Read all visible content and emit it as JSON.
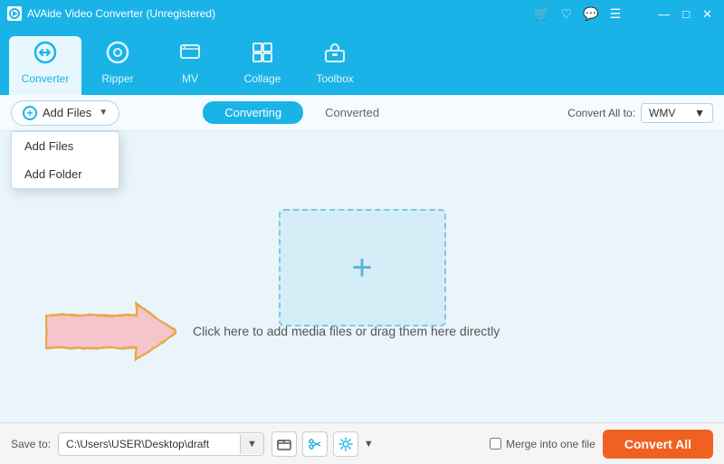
{
  "titlebar": {
    "title": "AVAide Video Converter (Unregistered)",
    "controls": {
      "minimize": "—",
      "maximize": "□",
      "close": "✕"
    },
    "icons": [
      "🛒",
      "♡",
      "💬",
      "☰"
    ]
  },
  "nav": {
    "items": [
      {
        "id": "converter",
        "label": "Converter",
        "icon": "↺",
        "active": true
      },
      {
        "id": "ripper",
        "label": "Ripper",
        "icon": "○",
        "active": false
      },
      {
        "id": "mv",
        "label": "MV",
        "icon": "🖼",
        "active": false
      },
      {
        "id": "collage",
        "label": "Collage",
        "icon": "⊞",
        "active": false
      },
      {
        "id": "toolbox",
        "label": "Toolbox",
        "icon": "🧰",
        "active": false
      }
    ]
  },
  "toolbar": {
    "add_files_label": "Add Files",
    "dropdown_items": [
      "Add Files",
      "Add Folder"
    ],
    "tabs": [
      "Converting",
      "Converted"
    ],
    "active_tab": "Converting",
    "convert_all_to_label": "Convert All to:",
    "format": "WMV"
  },
  "main": {
    "drop_zone_hint": "Click here to add media files or drag them here directly",
    "plus_symbol": "+"
  },
  "bottom": {
    "save_to_label": "Save to:",
    "save_path": "C:\\Users\\USER\\Desktop\\draft",
    "merge_label": "Merge into one file",
    "convert_all_label": "Convert All"
  }
}
